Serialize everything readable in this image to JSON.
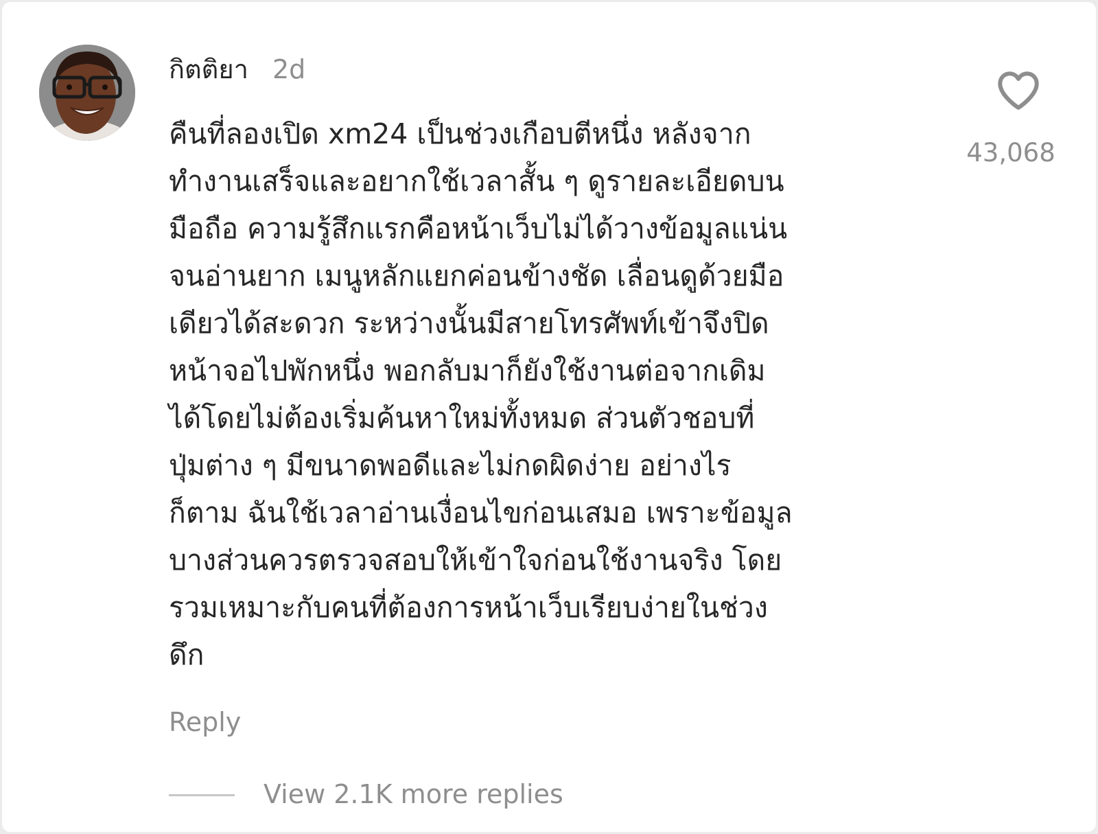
{
  "comment": {
    "username": "กิตติยา",
    "timestamp": "2d",
    "lines": [
      "คืนที่ลองเปิด xm24 เป็นช่วงเกือบตีหนึ่ง หลังจาก",
      "ทำงานเสร็จและอยากใช้เวลาสั้น ๆ ดูรายละเอียดบน",
      "มือถือ ความรู้สึกแรกคือหน้าเว็บไม่ได้วางข้อมูลแน่น",
      "จนอ่านยาก เมนูหลักแยกค่อนข้างชัด เลื่อนดูด้วยมือ",
      "เดียวได้สะดวก ระหว่างนั้นมีสายโทรศัพท์เข้าจึงปิด",
      "หน้าจอไปพักหนึ่ง พอกลับมาก็ยังใช้งานต่อจากเดิม",
      "ได้โดยไม่ต้องเริ่มค้นหาใหม่ทั้งหมด ส่วนตัวชอบที่",
      "ปุ่มต่าง ๆ มีขนาดพอดีและไม่กดผิดง่าย อย่างไร",
      "ก็ตาม ฉันใช้เวลาอ่านเงื่อนไขก่อนเสมอ เพราะข้อมูล",
      "บางส่วนควรตรวจสอบให้เข้าใจก่อนใช้งานจริง โดย",
      "รวมเหมาะกับคนที่ต้องการหน้าเว็บเรียบง่ายในช่วง",
      "ดึก"
    ],
    "like_count": "43,068",
    "reply_label": "Reply",
    "view_replies_label": "View 2.1K more replies"
  },
  "icons": {
    "like": "heart-outline-icon",
    "avatar": "user-avatar-photo"
  },
  "colors": {
    "primary_text": "#262626",
    "secondary_text": "#8e8e8e",
    "divider": "#c7c7c7",
    "background": "#ffffff"
  }
}
